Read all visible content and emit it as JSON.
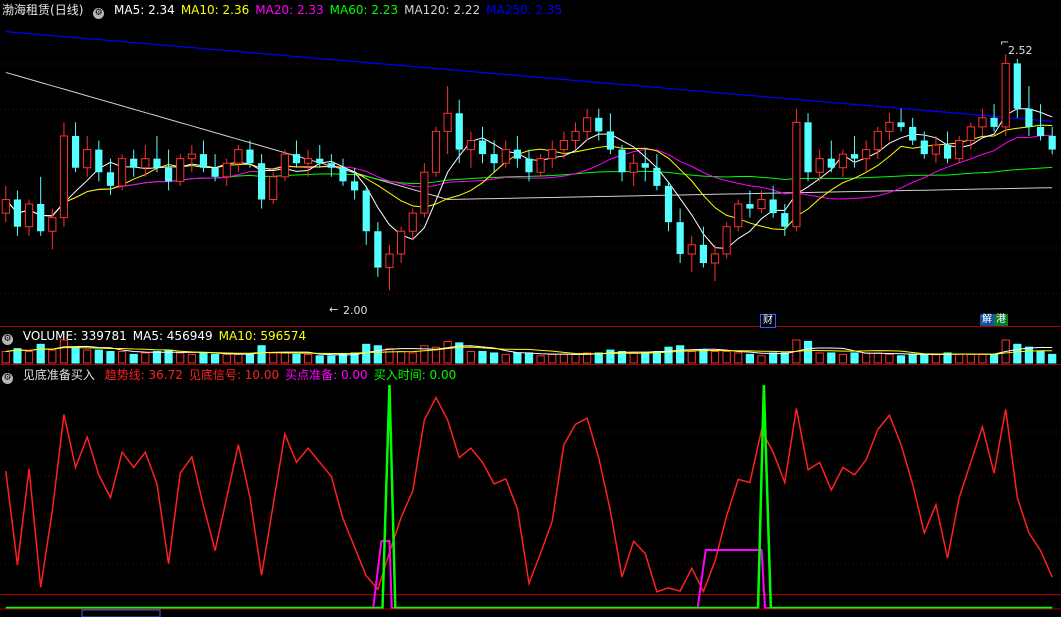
{
  "stock": {
    "name": "渤海租赁",
    "period": "(日线)"
  },
  "ma_header": [
    {
      "label": "MA5:",
      "value": "2.34",
      "color": "#ffffff"
    },
    {
      "label": "MA10:",
      "value": "2.36",
      "color": "#ffff00"
    },
    {
      "label": "MA20:",
      "value": "2.33",
      "color": "#ff00ff"
    },
    {
      "label": "MA60:",
      "value": "2.23",
      "color": "#00ff00"
    },
    {
      "label": "MA120:",
      "value": "2.22",
      "color": "#d0d0d0"
    },
    {
      "label": "MA250:",
      "value": "2.35",
      "color": "#0000ff"
    }
  ],
  "price_annotations": {
    "high": "2.52",
    "low": "2.00"
  },
  "event_badges": {
    "finance": "财",
    "combo_a": "解",
    "combo_b": "港"
  },
  "volume_header": [
    {
      "label": "VOLUME:",
      "value": "339781",
      "color": "#ffffff"
    },
    {
      "label": "MA5:",
      "value": "456949",
      "color": "#ffffff"
    },
    {
      "label": "MA10:",
      "value": "596574",
      "color": "#ffff00"
    }
  ],
  "indicator_header": {
    "name": "见底准备买入",
    "items": [
      {
        "label": "趋势线:",
        "value": "36.72",
        "color": "#ff2020"
      },
      {
        "label": "见底信号:",
        "value": "10.00",
        "color": "#ff2020"
      },
      {
        "label": "买点准备:",
        "value": "0.00",
        "color": "#ff00ff"
      },
      {
        "label": "买入时间:",
        "value": "0.00",
        "color": "#00ff00"
      }
    ]
  },
  "colors": {
    "background": "#000000",
    "up": "#ff3030",
    "down": "#54ffff",
    "grid": "#7a0000",
    "ma5": "#ffffff",
    "ma10": "#ffff00",
    "ma20": "#ff00ff",
    "ma60": "#00ff00",
    "ma120": "#d0d0d0",
    "ma250": "#0000ff",
    "trend": "#ff2020",
    "buy_prep": "#ff00ff",
    "buy_time": "#00ff00"
  },
  "chart_data": {
    "type": "candlestick",
    "price_range": [
      1.93,
      2.6
    ],
    "candles": [
      [
        2.17,
        2.23,
        2.15,
        2.2
      ],
      [
        2.2,
        2.22,
        2.12,
        2.14
      ],
      [
        2.14,
        2.2,
        2.12,
        2.19
      ],
      [
        2.19,
        2.25,
        2.12,
        2.13
      ],
      [
        2.13,
        2.18,
        2.09,
        2.16
      ],
      [
        2.16,
        2.37,
        2.14,
        2.34
      ],
      [
        2.34,
        2.37,
        2.26,
        2.27
      ],
      [
        2.27,
        2.34,
        2.25,
        2.31
      ],
      [
        2.31,
        2.33,
        2.24,
        2.26
      ],
      [
        2.26,
        2.29,
        2.21,
        2.23
      ],
      [
        2.23,
        2.3,
        2.22,
        2.29
      ],
      [
        2.29,
        2.31,
        2.25,
        2.27
      ],
      [
        2.27,
        2.32,
        2.25,
        2.29
      ],
      [
        2.29,
        2.34,
        2.26,
        2.27
      ],
      [
        2.27,
        2.31,
        2.22,
        2.24
      ],
      [
        2.24,
        2.3,
        2.23,
        2.29
      ],
      [
        2.29,
        2.32,
        2.26,
        2.3
      ],
      [
        2.3,
        2.33,
        2.26,
        2.27
      ],
      [
        2.27,
        2.3,
        2.24,
        2.25
      ],
      [
        2.25,
        2.29,
        2.23,
        2.28
      ],
      [
        2.28,
        2.32,
        2.26,
        2.31
      ],
      [
        2.31,
        2.33,
        2.27,
        2.28
      ],
      [
        2.28,
        2.3,
        2.18,
        2.2
      ],
      [
        2.2,
        2.26,
        2.19,
        2.25
      ],
      [
        2.25,
        2.31,
        2.24,
        2.3
      ],
      [
        2.3,
        2.33,
        2.27,
        2.28
      ],
      [
        2.28,
        2.31,
        2.25,
        2.29
      ],
      [
        2.29,
        2.32,
        2.27,
        2.28
      ],
      [
        2.28,
        2.3,
        2.25,
        2.27
      ],
      [
        2.27,
        2.29,
        2.23,
        2.24
      ],
      [
        2.24,
        2.27,
        2.2,
        2.22
      ],
      [
        2.22,
        2.23,
        2.1,
        2.13
      ],
      [
        2.13,
        2.15,
        2.03,
        2.05
      ],
      [
        2.05,
        2.1,
        2.0,
        2.08
      ],
      [
        2.08,
        2.14,
        2.06,
        2.13
      ],
      [
        2.13,
        2.18,
        2.11,
        2.17
      ],
      [
        2.17,
        2.28,
        2.16,
        2.26
      ],
      [
        2.26,
        2.36,
        2.25,
        2.35
      ],
      [
        2.35,
        2.45,
        2.3,
        2.39
      ],
      [
        2.39,
        2.42,
        2.28,
        2.31
      ],
      [
        2.31,
        2.35,
        2.27,
        2.33
      ],
      [
        2.33,
        2.36,
        2.28,
        2.3
      ],
      [
        2.3,
        2.33,
        2.26,
        2.28
      ],
      [
        2.28,
        2.33,
        2.27,
        2.31
      ],
      [
        2.31,
        2.34,
        2.27,
        2.29
      ],
      [
        2.29,
        2.31,
        2.24,
        2.26
      ],
      [
        2.26,
        2.3,
        2.25,
        2.29
      ],
      [
        2.29,
        2.33,
        2.27,
        2.31
      ],
      [
        2.31,
        2.35,
        2.29,
        2.33
      ],
      [
        2.33,
        2.37,
        2.31,
        2.35
      ],
      [
        2.35,
        2.4,
        2.33,
        2.38
      ],
      [
        2.38,
        2.4,
        2.33,
        2.35
      ],
      [
        2.35,
        2.39,
        2.3,
        2.31
      ],
      [
        2.31,
        2.32,
        2.24,
        2.26
      ],
      [
        2.26,
        2.3,
        2.23,
        2.28
      ],
      [
        2.28,
        2.31,
        2.24,
        2.27
      ],
      [
        2.27,
        2.3,
        2.22,
        2.23
      ],
      [
        2.23,
        2.24,
        2.13,
        2.15
      ],
      [
        2.15,
        2.18,
        2.06,
        2.08
      ],
      [
        2.08,
        2.12,
        2.04,
        2.1
      ],
      [
        2.1,
        2.14,
        2.05,
        2.06
      ],
      [
        2.06,
        2.1,
        2.02,
        2.08
      ],
      [
        2.08,
        2.15,
        2.07,
        2.14
      ],
      [
        2.14,
        2.2,
        2.13,
        2.19
      ],
      [
        2.19,
        2.22,
        2.16,
        2.18
      ],
      [
        2.18,
        2.22,
        2.17,
        2.2
      ],
      [
        2.2,
        2.23,
        2.16,
        2.17
      ],
      [
        2.17,
        2.19,
        2.12,
        2.14
      ],
      [
        2.14,
        2.4,
        2.13,
        2.37
      ],
      [
        2.37,
        2.39,
        2.24,
        2.26
      ],
      [
        2.26,
        2.31,
        2.24,
        2.29
      ],
      [
        2.29,
        2.33,
        2.26,
        2.27
      ],
      [
        2.27,
        2.31,
        2.25,
        2.3
      ],
      [
        2.3,
        2.34,
        2.27,
        2.29
      ],
      [
        2.29,
        2.33,
        2.26,
        2.31
      ],
      [
        2.31,
        2.36,
        2.29,
        2.35
      ],
      [
        2.35,
        2.39,
        2.33,
        2.37
      ],
      [
        2.37,
        2.4,
        2.35,
        2.36
      ],
      [
        2.36,
        2.38,
        2.32,
        2.33
      ],
      [
        2.33,
        2.35,
        2.29,
        2.3
      ],
      [
        2.3,
        2.34,
        2.28,
        2.32
      ],
      [
        2.32,
        2.35,
        2.28,
        2.29
      ],
      [
        2.29,
        2.34,
        2.28,
        2.33
      ],
      [
        2.33,
        2.37,
        2.31,
        2.36
      ],
      [
        2.36,
        2.4,
        2.34,
        2.38
      ],
      [
        2.38,
        2.41,
        2.35,
        2.36
      ],
      [
        2.36,
        2.52,
        2.34,
        2.5
      ],
      [
        2.5,
        2.51,
        2.38,
        2.4
      ],
      [
        2.4,
        2.45,
        2.34,
        2.36
      ],
      [
        2.36,
        2.41,
        2.33,
        2.34
      ],
      [
        2.34,
        2.36,
        2.3,
        2.31
      ]
    ],
    "volume_range": [
      0,
      1
    ],
    "indicator_range": [
      0,
      100
    ],
    "buy_prep_level": 26,
    "buy_time_level": 0,
    "reference_level": 6
  }
}
